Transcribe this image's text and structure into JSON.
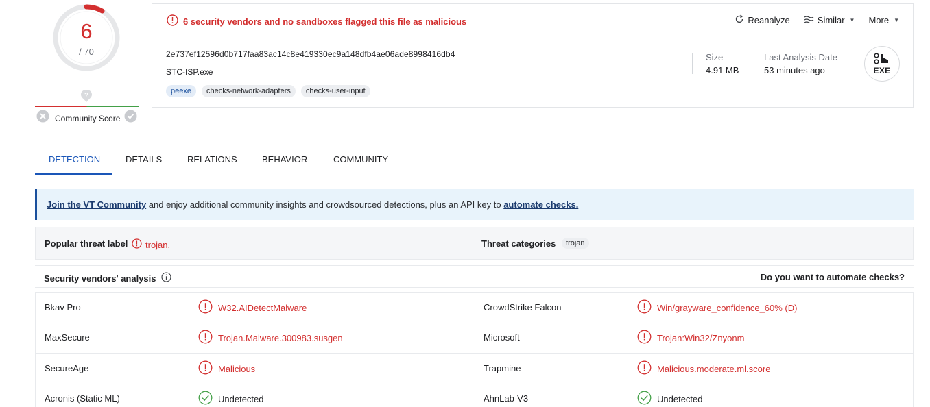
{
  "score": {
    "detections": "6",
    "total": "/ 70"
  },
  "community": {
    "label": "Community Score"
  },
  "alert": {
    "text": "6 security vendors and no sandboxes flagged this file as malicious"
  },
  "actions": {
    "reanalyze": "Reanalyze",
    "similar": "Similar",
    "more": "More"
  },
  "file": {
    "hash": "2e737ef12596d0b717faa83ac14c8e419330ec9a148dfb4ae06ade8998416db4",
    "name": "STC-ISP.exe",
    "tags": [
      "peexe",
      "checks-network-adapters",
      "checks-user-input"
    ],
    "size_label": "Size",
    "size_value": "4.91 MB",
    "last_analysis_label": "Last Analysis Date",
    "last_analysis_value": "53 minutes ago",
    "type_badge": "EXE"
  },
  "tabs": [
    "DETECTION",
    "DETAILS",
    "RELATIONS",
    "BEHAVIOR",
    "COMMUNITY"
  ],
  "banner": {
    "link1": "Join the VT Community",
    "middle": " and enjoy additional community insights and crowdsourced detections, plus an API key to ",
    "link2": "automate checks."
  },
  "threat": {
    "popular_label": "Popular threat label",
    "popular_value": "trojan.",
    "categories_label": "Threat categories",
    "categories_value": "trojan"
  },
  "vendors_header": {
    "title": "Security vendors' analysis",
    "automate": "Do you want to automate checks?"
  },
  "vendors": [
    {
      "left_name": "Bkav Pro",
      "left_result": "W32.AIDetectMalware",
      "left_status": "malicious",
      "right_name": "CrowdStrike Falcon",
      "right_result": "Win/grayware_confidence_60% (D)",
      "right_status": "malicious"
    },
    {
      "left_name": "MaxSecure",
      "left_result": "Trojan.Malware.300983.susgen",
      "left_status": "malicious",
      "right_name": "Microsoft",
      "right_result": "Trojan:Win32/Znyonm",
      "right_status": "malicious"
    },
    {
      "left_name": "SecureAge",
      "left_result": "Malicious",
      "left_status": "malicious",
      "right_name": "Trapmine",
      "right_result": "Malicious.moderate.ml.score",
      "right_status": "malicious"
    },
    {
      "left_name": "Acronis (Static ML)",
      "left_result": "Undetected",
      "left_status": "undetected",
      "right_name": "AhnLab-V3",
      "right_result": "Undetected",
      "right_status": "undetected"
    }
  ],
  "colors": {
    "malicious": "#d32f2f",
    "clean": "#43a047",
    "accent": "#1a56b8"
  }
}
